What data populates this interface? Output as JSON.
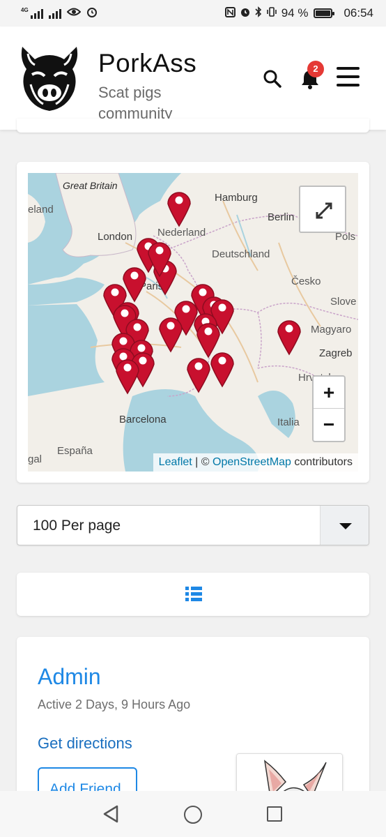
{
  "status_bar": {
    "network_tag": "4G",
    "battery_percent": "94 %",
    "time": "06:54",
    "icons": [
      "signal-icon",
      "eye-icon",
      "alarm-icon",
      "nfc-icon",
      "bluetooth-icon",
      "vibrate-icon",
      "battery-icon"
    ]
  },
  "header": {
    "site_name": "PorkAss",
    "tagline": "Scat pigs community",
    "notification_count": "2"
  },
  "map": {
    "labels": {
      "great_britain": "Great Britain",
      "ireland": "eland",
      "hamburg": "Hamburg",
      "nederland": "Nederland",
      "berlin": "Berlin",
      "london": "London",
      "pols": "Pols",
      "deutschland": "Deutschland",
      "paris": "Paris",
      "cesko": "Česko",
      "slove": "Slove",
      "magyar": "Magyaro",
      "zagreb": "Zagreb",
      "hrvatska": "Hrvatsk",
      "barcelona": "Barcelona",
      "italia": "Italia",
      "espana": "España",
      "portugal": "gal"
    },
    "zoom_in": "+",
    "zoom_out": "−",
    "attribution": {
      "leaflet": "Leaflet",
      "separator": " | © ",
      "osm": "OpenStreetMap",
      "suffix": " contributors"
    },
    "marker_count": 24
  },
  "per_page": {
    "selected": "100 Per page"
  },
  "member": {
    "name": "Admin",
    "activity": "Active 2 Days, 9 Hours Ago",
    "directions_link": "Get directions",
    "add_friend_label": "Add Friend"
  },
  "colors": {
    "accent": "#1e88e5",
    "marker": "#c8102e",
    "badge": "#e53935"
  }
}
